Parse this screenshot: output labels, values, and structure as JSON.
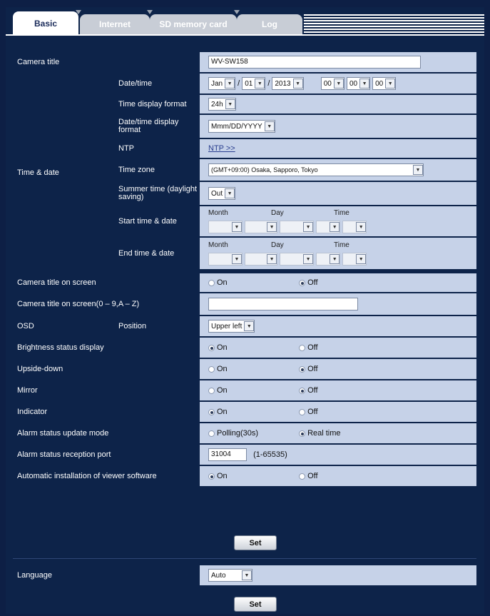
{
  "tabs": [
    {
      "label": "Basic"
    },
    {
      "label": "Internet"
    },
    {
      "label": "SD memory card"
    },
    {
      "label": "Log"
    }
  ],
  "camera_title": {
    "label": "Camera title",
    "value": "WV-SW158"
  },
  "time_date": {
    "label": "Time & date",
    "datetime": {
      "label": "Date/time",
      "month": "Jan",
      "day": "01",
      "year": "2013",
      "hour": "00",
      "minute": "00",
      "second": "00",
      "sep": "/"
    },
    "time_display_format": {
      "label": "Time display format",
      "value": "24h"
    },
    "datetime_display_format": {
      "label": "Date/time display format",
      "value": "Mmm/DD/YYYY"
    },
    "ntp": {
      "label": "NTP",
      "link": "NTP >>"
    },
    "time_zone": {
      "label": "Time zone",
      "value": "(GMT+09:00) Osaka, Sapporo, Tokyo"
    },
    "summer_time": {
      "label": "Summer time (daylight saving)",
      "value": "Out"
    },
    "start": {
      "label": "Start time & date",
      "month": "Month",
      "day": "Day",
      "time": "Time"
    },
    "end": {
      "label": "End time & date",
      "month": "Month",
      "day": "Day",
      "time": "Time"
    }
  },
  "camera_title_on_screen": {
    "label": "Camera title on screen",
    "on": "On",
    "off": "Off",
    "selected": "off"
  },
  "camera_title_on_screen_text": {
    "label": "Camera title on screen(0 – 9,A – Z)",
    "value": ""
  },
  "osd": {
    "label": "OSD",
    "position_label": "Position",
    "value": "Upper left"
  },
  "radios": [
    {
      "label": "Brightness status display",
      "opt1": "On",
      "opt2": "Off",
      "selected": 1
    },
    {
      "label": "Upside-down",
      "opt1": "On",
      "opt2": "Off",
      "selected": 2
    },
    {
      "label": "Mirror",
      "opt1": "On",
      "opt2": "Off",
      "selected": 2
    },
    {
      "label": "Indicator",
      "opt1": "On",
      "opt2": "Off",
      "selected": 1
    },
    {
      "label": "Alarm status update mode",
      "opt1": "Polling(30s)",
      "opt2": "Real time",
      "selected": 2
    }
  ],
  "alarm_port": {
    "label": "Alarm status reception port",
    "value": "31004",
    "range": "(1-65535)"
  },
  "auto_install": {
    "label": "Automatic installation of viewer software",
    "opt1": "On",
    "opt2": "Off",
    "selected": 1
  },
  "set1": "Set",
  "language": {
    "label": "Language",
    "value": "Auto"
  },
  "set2": "Set"
}
